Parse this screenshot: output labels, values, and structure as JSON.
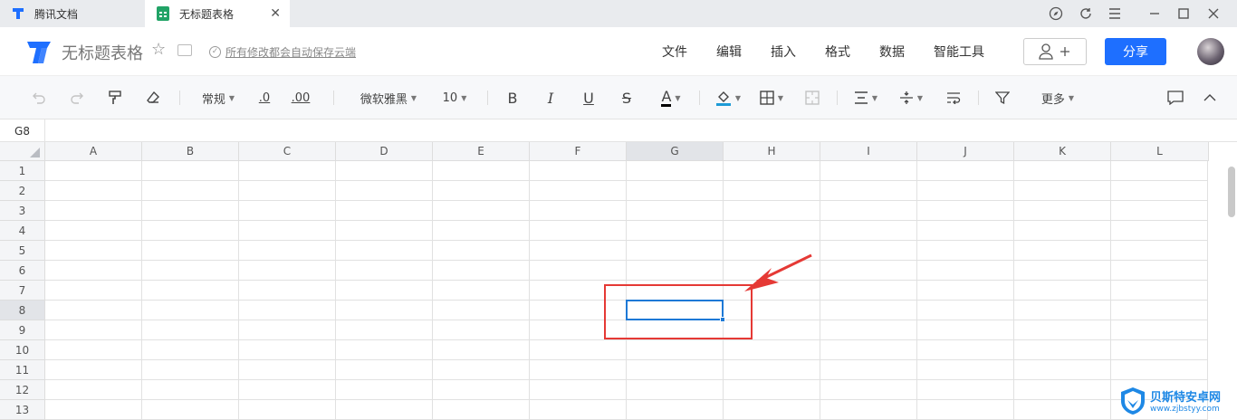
{
  "tabs": [
    {
      "label": "腾讯文档"
    },
    {
      "label": "无标题表格"
    }
  ],
  "doc": {
    "title": "无标题表格",
    "save_status": "所有修改都会自动保存云端"
  },
  "menu": [
    "文件",
    "编辑",
    "插入",
    "格式",
    "数据",
    "智能工具"
  ],
  "share_label": "分享",
  "toolbar": {
    "number_format": "常规",
    "decrease_decimal": ".0",
    "increase_decimal": ".00",
    "font_family": "微软雅黑",
    "font_size": "10",
    "bold": "B",
    "italic": "I",
    "underline": "U",
    "strikethrough": "S",
    "font_color": "A",
    "more": "更多"
  },
  "formula_bar": {
    "cell_ref": "G8"
  },
  "sheet": {
    "columns": [
      "A",
      "B",
      "C",
      "D",
      "E",
      "F",
      "G",
      "H",
      "I",
      "J",
      "K",
      "L"
    ],
    "rows": [
      "1",
      "2",
      "3",
      "4",
      "5",
      "6",
      "7",
      "8",
      "9",
      "10",
      "11",
      "12",
      "13"
    ],
    "selected_column": "G",
    "selected_row": "8"
  },
  "watermark": {
    "title": "贝斯特安卓网",
    "url": "www.zjbstyy.com"
  },
  "colors": {
    "accent": "#1e6fff",
    "selection": "#1e79d6",
    "annotation": "#e53935",
    "sheets_green": "#21a366"
  }
}
